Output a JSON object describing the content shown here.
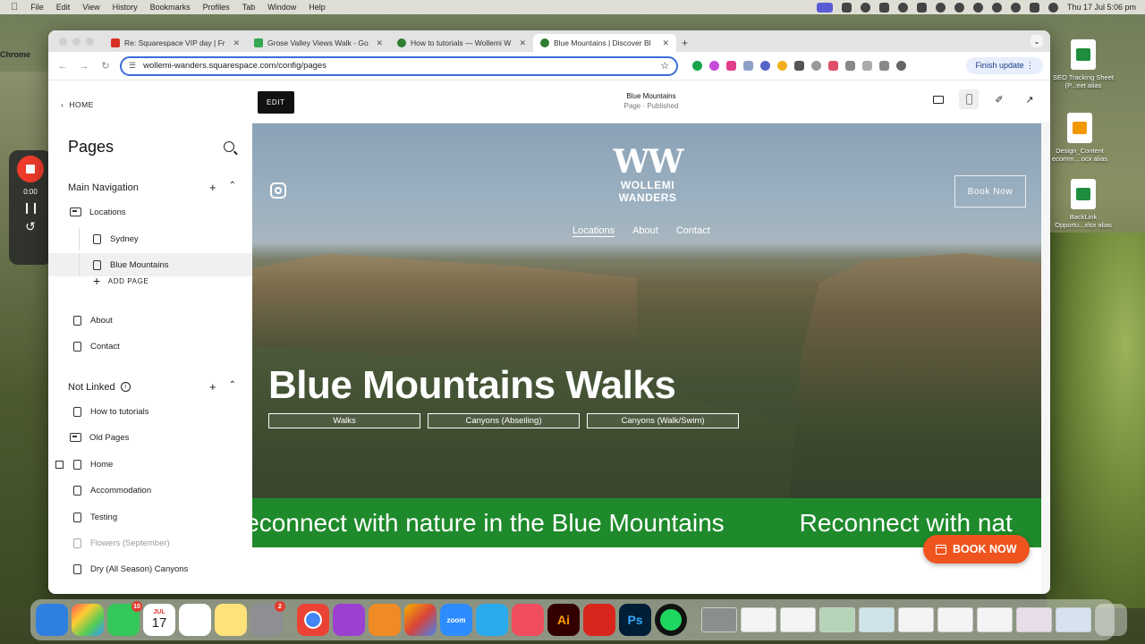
{
  "menubar": {
    "app": "Chrome",
    "menus": [
      "File",
      "Edit",
      "View",
      "History",
      "Bookmarks",
      "Profiles",
      "Tab",
      "Window",
      "Help"
    ],
    "clock": "Thu 17 Jul  5:06 pm"
  },
  "browser": {
    "tabs": [
      {
        "title": "Re: Squarespace VIP day | Fr",
        "color": "#d93025"
      },
      {
        "title": "Grose Valley Views Walk - Go",
        "color": "#34a853"
      },
      {
        "title": "How to tutorials — Wollemi W",
        "color": "#2e7d32"
      },
      {
        "title": "Blue Mountains | Discover Bl",
        "color": "#2e7d32"
      }
    ],
    "url": "wollemi-wanders.squarespace.com/config/pages",
    "finish_update": "Finish update"
  },
  "sidebar": {
    "home_link": "HOME",
    "title": "Pages",
    "main_nav_heading": "Main Navigation",
    "main_nav_items": [
      {
        "label": "Locations",
        "kind": "folder"
      },
      {
        "label": "Sydney",
        "kind": "page",
        "child": true
      },
      {
        "label": "Blue Mountains",
        "kind": "page",
        "child": true,
        "selected": true
      }
    ],
    "add_page": "ADD PAGE",
    "main_nav_after": [
      {
        "label": "About",
        "kind": "page"
      },
      {
        "label": "Contact",
        "kind": "page"
      }
    ],
    "not_linked_heading": "Not Linked",
    "not_linked_items": [
      {
        "label": "How to tutorials",
        "kind": "page"
      },
      {
        "label": "Old Pages",
        "kind": "folder"
      },
      {
        "label": "Home",
        "kind": "page",
        "homepage": true
      },
      {
        "label": "Accommodation",
        "kind": "page"
      },
      {
        "label": "Testing",
        "kind": "page"
      },
      {
        "label": "Flowers (September)",
        "kind": "page",
        "muted": true
      },
      {
        "label": "Dry (All Season) Canyons",
        "kind": "page"
      }
    ]
  },
  "preview": {
    "edit_button": "EDIT",
    "page_name": "Blue Mountains",
    "page_status": "Page · Published"
  },
  "site": {
    "logo_mark": "WW",
    "logo_name": "WOLLEMI WANDERS",
    "nav": [
      "Locations",
      "About",
      "Contact"
    ],
    "book_outline": "Book Now",
    "hero_title": "Blue Mountains Walks",
    "hero_buttons": [
      "Walks",
      "Canyons (Abseiling)",
      "Canyons (Walk/Swim)"
    ],
    "marquee": [
      "Reconnect with nature in the Blue Mountains",
      "Reconnect with nat"
    ],
    "book_pill": "BOOK NOW"
  },
  "recorder": {
    "time": "0:00"
  },
  "desktop_icons": [
    {
      "label": "SEO Tracking Sheet (P...eet alias",
      "color": "#1e8e3e"
    },
    {
      "label": "Design_Content ecomm....ocx alias",
      "color": "#f29900"
    },
    {
      "label": "BackLink Opportu...xlsx alias",
      "color": "#1e8e3e"
    }
  ],
  "dock": {
    "calendar_month": "JUL",
    "calendar_day": "17",
    "messages_badge": "10",
    "settings_badge": "2",
    "zoom_label": "zoom",
    "illustrator_label": "Ai",
    "photoshop_label": "Ps"
  }
}
